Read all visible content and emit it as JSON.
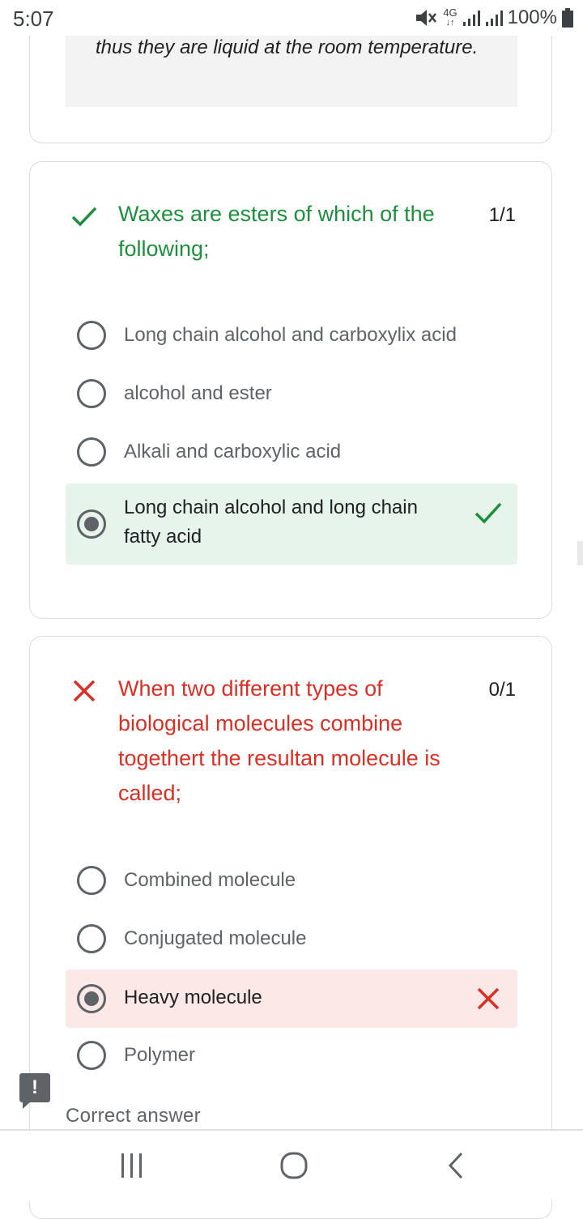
{
  "status_bar": {
    "time": "5:07",
    "network": "4G",
    "battery": "100%",
    "icons": [
      "mute-icon",
      "network-4g-icon",
      "signal-icon",
      "signal-icon",
      "battery-icon"
    ]
  },
  "previous_card": {
    "explanation_text": "thus they are liquid at the room temperature."
  },
  "questions": [
    {
      "status": "correct",
      "title": "Waxes are esters of which of the following;",
      "title_lines": [
        "Waxes are esters of which of the",
        "following;"
      ],
      "score": "1/1",
      "options": [
        {
          "label": "Long chain alcohol and carboxylix acid",
          "selected": false
        },
        {
          "label": "alcohol and ester",
          "selected": false
        },
        {
          "label": "Alkali and carboxylic acid",
          "selected": false
        },
        {
          "label": "Long chain alcohol and long chain fatty acid",
          "label_lines": [
            "Long chain alcohol and long chain",
            "fatty acid"
          ],
          "selected": true,
          "result": "correct"
        }
      ]
    },
    {
      "status": "incorrect",
      "title": "When two different types of biological molecules combine togethert the resultan molecule is called;",
      "title_lines": [
        "When two different types of",
        "biological molecules combine",
        "togethert the resultan molecule is",
        "called;"
      ],
      "score": "0/1",
      "options": [
        {
          "label": "Combined molecule",
          "selected": false
        },
        {
          "label": "Conjugated molecule",
          "selected": false
        },
        {
          "label": "Heavy molecule",
          "selected": true,
          "result": "incorrect"
        },
        {
          "label": "Polymer",
          "selected": false
        }
      ],
      "correct_answer_label": "Correct answer"
    }
  ],
  "colors": {
    "correct": "#1e8e3e",
    "incorrect": "#d93025",
    "correct_bg": "#e6f4ea",
    "incorrect_bg": "#fce8e6"
  },
  "nav_bar": {
    "icons": [
      "recent-apps-icon",
      "home-icon",
      "back-icon"
    ]
  }
}
